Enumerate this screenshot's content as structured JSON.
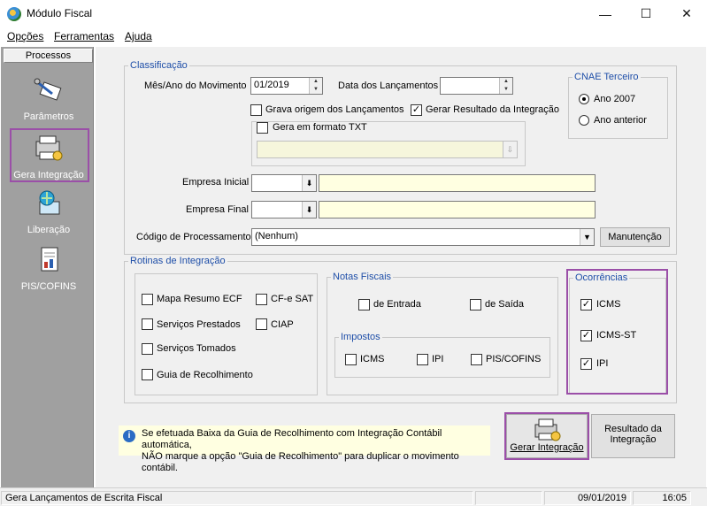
{
  "window": {
    "title": "Módulo Fiscal",
    "minimize": "—",
    "maximize": "☐",
    "close": "✕"
  },
  "menu": [
    {
      "label": "Opções"
    },
    {
      "label": "Ferramentas"
    },
    {
      "label": "Ajuda"
    }
  ],
  "sidebar": {
    "header": "Processos",
    "items": [
      {
        "label": "Parâmetros"
      },
      {
        "label": "Gera Integração"
      },
      {
        "label": "Liberação"
      },
      {
        "label": "PIS/COFINS"
      }
    ]
  },
  "classificacao": {
    "legend": "Classificação",
    "mes_ano_label": "Mês/Ano do Movimento",
    "mes_ano_value": "01/2019",
    "data_lanc_label": "Data dos Lançamentos",
    "data_lanc_value": "",
    "grava_origem": {
      "label": "Grava origem dos Lançamentos",
      "checked": false
    },
    "gerar_resultado": {
      "label": "Gerar Resultado da Integração",
      "checked": true
    },
    "gera_txt": {
      "label": "Gera em formato TXT",
      "checked": false
    },
    "empresa_inicial_label": "Empresa Inicial",
    "empresa_final_label": "Empresa Final",
    "codigo_proc_label": "Código de Processamento",
    "codigo_proc_value": "(Nenhum)",
    "manutencao_label": "Manutenção"
  },
  "cnae": {
    "legend": "CNAE Terceiro",
    "options": [
      {
        "label": "Ano 2007",
        "selected": true
      },
      {
        "label": "Ano anterior",
        "selected": false
      }
    ]
  },
  "rotinas": {
    "legend": "Rotinas de Integração",
    "left": [
      {
        "label": "Mapa Resumo ECF",
        "checked": false
      },
      {
        "label": "Serviços Prestados",
        "checked": false
      },
      {
        "label": "Serviços Tomados",
        "checked": false
      },
      {
        "label": "Guia de Recolhimento",
        "checked": false
      }
    ],
    "right": [
      {
        "label": "CF-e SAT",
        "checked": false
      },
      {
        "label": "CIAP",
        "checked": false
      }
    ]
  },
  "notas": {
    "legend": "Notas Fiscais",
    "entrada": {
      "label": "de Entrada",
      "checked": false
    },
    "saida": {
      "label": "de Saída",
      "checked": false
    },
    "impostos_legend": "Impostos",
    "impostos": [
      {
        "label": "ICMS",
        "checked": false
      },
      {
        "label": "IPI",
        "checked": false
      },
      {
        "label": "PIS/COFINS",
        "checked": false
      }
    ]
  },
  "ocorrencias": {
    "legend": "Ocorrências",
    "items": [
      {
        "label": "ICMS",
        "checked": true
      },
      {
        "label": "ICMS-ST",
        "checked": true
      },
      {
        "label": "IPI",
        "checked": true
      }
    ]
  },
  "info": {
    "line1": "Se efetuada Baixa da Guia de Recolhimento com Integração Contábil automática,",
    "line2": "NÃO marque a opção \"Guia de Recolhimento\" para duplicar o movimento contábil."
  },
  "buttons": {
    "gerar": "Gerar Integração",
    "resultado_line1": "Resultado da",
    "resultado_line2": "Integração"
  },
  "status": {
    "text": "Gera Lançamentos de Escrita Fiscal",
    "date": "09/01/2019",
    "time": "16:05"
  },
  "colors": {
    "highlight": "#9b4fa8",
    "legend": "#1e4ea8",
    "sidebar": "#a0a0a0"
  }
}
